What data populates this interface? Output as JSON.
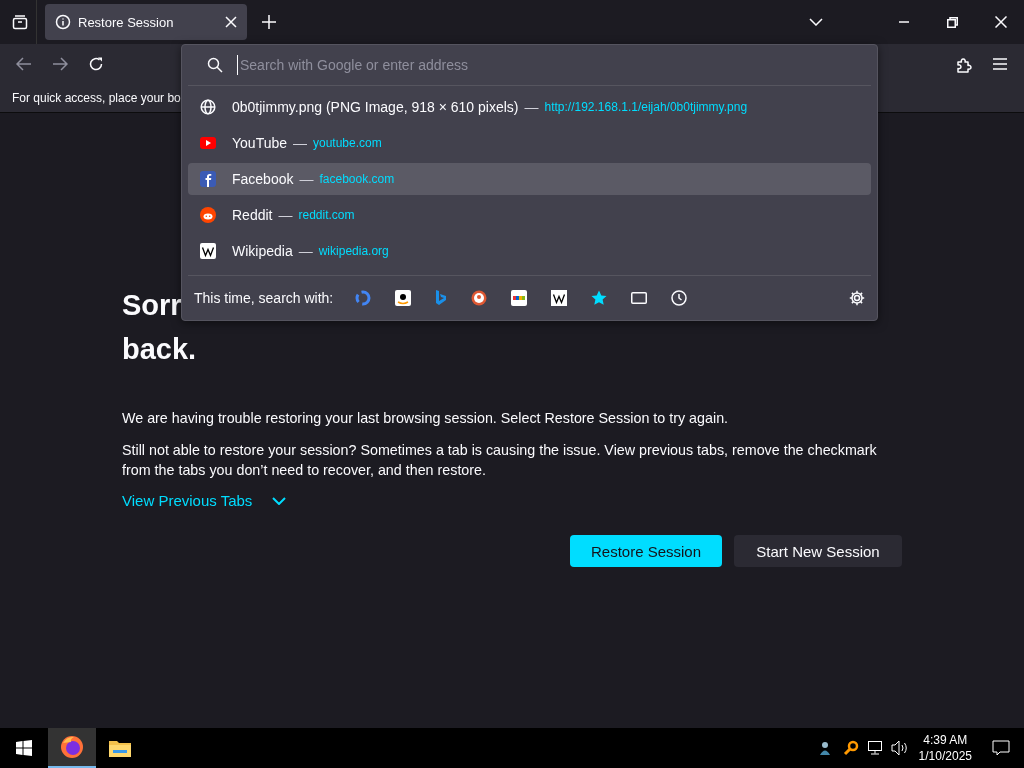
{
  "tab_bar": {
    "tabs": [
      {
        "title": "Restore Session",
        "selected": true
      }
    ]
  },
  "bookmarks_bar": {
    "text": "For quick access, place your bo"
  },
  "address_popup": {
    "placeholder": "Search with Google or enter address",
    "results": [
      {
        "kind": "globe",
        "title": "0b0tjimmy.png (PNG Image, 918 × 610 pixels)",
        "separator": "—",
        "url": "http://192.168.1.1/eijah/0b0tjimmy.png",
        "selected": false
      },
      {
        "kind": "youtube",
        "title": "YouTube",
        "separator": "—",
        "url": "youtube.com",
        "selected": false
      },
      {
        "kind": "facebook",
        "title": "Facebook",
        "separator": "—",
        "url": "facebook.com",
        "selected": true
      },
      {
        "kind": "reddit",
        "title": "Reddit",
        "separator": "—",
        "url": "reddit.com",
        "selected": false
      },
      {
        "kind": "wikipedia",
        "title": "Wikipedia",
        "separator": "—",
        "url": "wikipedia.org",
        "selected": false
      }
    ],
    "search_with_label": "This time, search with:"
  },
  "page": {
    "heading_lines": [
      "Sorr",
      "back."
    ],
    "paragraphs": [
      "We are having trouble restoring your last browsing session. Select Restore Session to try again.",
      "Still not able to restore your session? Sometimes a tab is causing the issue. View previous tabs, remove the checkmark from the tabs you don’t need to recover, and then restore."
    ],
    "view_previous_tabs": "View Previous Tabs",
    "buttons": [
      {
        "label": "Restore Session",
        "kind": "primary"
      },
      {
        "label": "Start New Session",
        "kind": "secondary"
      }
    ]
  },
  "taskbar": {
    "apps": [
      {
        "kind": "browser",
        "selected": true
      },
      {
        "kind": "folder",
        "selected": false
      }
    ],
    "time": "4:39 AM",
    "date": "1/10/2025"
  }
}
